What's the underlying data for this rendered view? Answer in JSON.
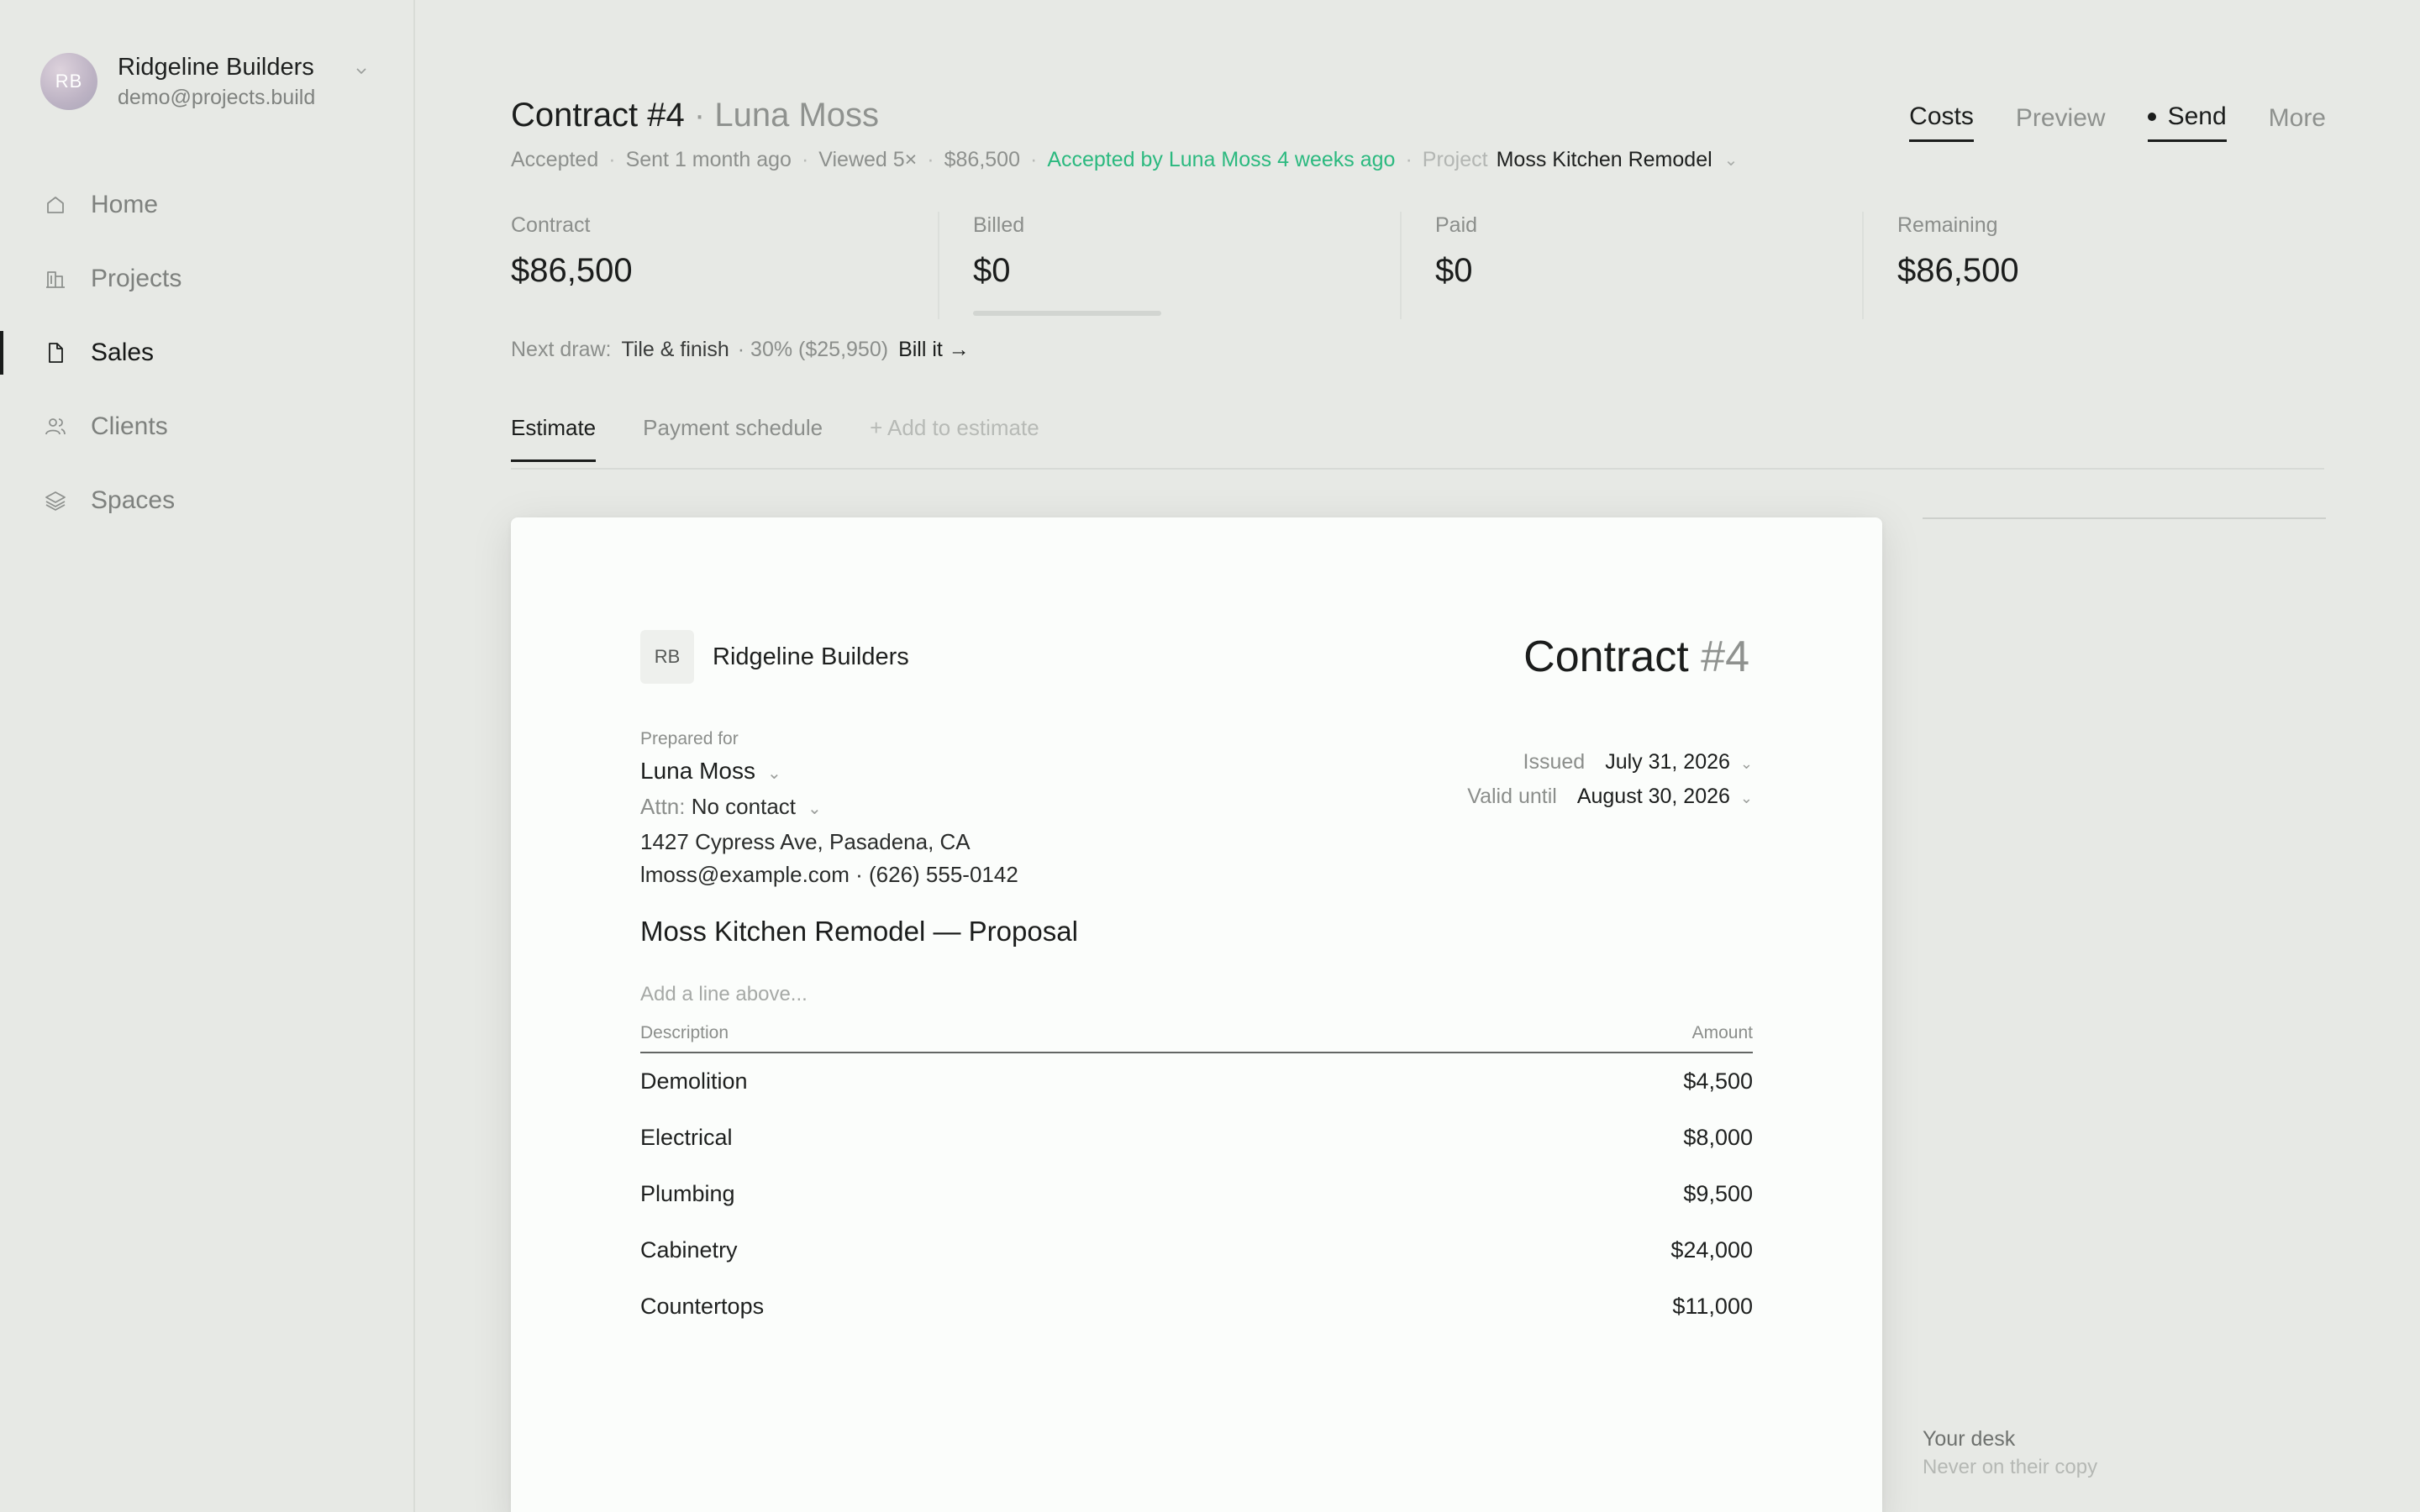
{
  "account": {
    "initials": "RB",
    "name": "Ridgeline Builders",
    "email": "demo@projects.build"
  },
  "nav": {
    "items": [
      {
        "label": "Home",
        "icon": "home-icon"
      },
      {
        "label": "Projects",
        "icon": "buildings-icon"
      },
      {
        "label": "Sales",
        "icon": "document-icon",
        "active": true
      },
      {
        "label": "Clients",
        "icon": "people-icon"
      },
      {
        "label": "Spaces",
        "icon": "layers-icon"
      }
    ]
  },
  "header": {
    "title": "Contract #4",
    "separator": "·",
    "client": "Luna Moss",
    "meta": {
      "status": "Accepted",
      "sent": "Sent 1 month ago",
      "viewed": "Viewed 5×",
      "amount": "$86,500",
      "accepted_by": "Accepted by Luna Moss 4 weeks ago",
      "project_label": "Project",
      "project_name": "Moss Kitchen Remodel"
    },
    "actions": {
      "costs": "Costs",
      "preview": "Preview",
      "send": "Send",
      "more": "More"
    }
  },
  "stats": {
    "contract_label": "Contract",
    "contract_value": "$86,500",
    "billed_label": "Billed",
    "billed_value": "$0",
    "paid_label": "Paid",
    "paid_value": "$0",
    "remaining_label": "Remaining",
    "remaining_value": "$86,500"
  },
  "next_draw": {
    "label": "Next draw:",
    "phase": "Tile & finish",
    "amount": "· 30% ($25,950)",
    "action": "Bill it →"
  },
  "tabs": {
    "estimate": "Estimate",
    "payment_schedule": "Payment schedule",
    "add_to_estimate": "+ Add to estimate"
  },
  "document": {
    "company_initials": "RB",
    "company_name": "Ridgeline Builders",
    "title_word": "Contract",
    "title_number": "#4",
    "prepared_for_label": "Prepared for",
    "client_name": "Luna Moss",
    "attn_label": "Attn:",
    "attn_value": "No contact",
    "address": "1427 Cypress Ave, Pasadena, CA",
    "contact": "lmoss@example.com · (626) 555-0142",
    "issued_label": "Issued",
    "issued_value": "July 31, 2026",
    "valid_label": "Valid until",
    "valid_value": "August 30, 2026",
    "proposal_title": "Moss Kitchen Remodel — Proposal",
    "add_line_placeholder": "Add a line above...",
    "table": {
      "col_description": "Description",
      "col_amount": "Amount",
      "rows": [
        {
          "description": "Demolition",
          "amount": "$4,500"
        },
        {
          "description": "Electrical",
          "amount": "$8,000"
        },
        {
          "description": "Plumbing",
          "amount": "$9,500"
        },
        {
          "description": "Cabinetry",
          "amount": "$24,000"
        },
        {
          "description": "Countertops",
          "amount": "$11,000"
        }
      ]
    }
  },
  "desk": {
    "title": "Your desk",
    "subtitle": "Never on their copy"
  }
}
